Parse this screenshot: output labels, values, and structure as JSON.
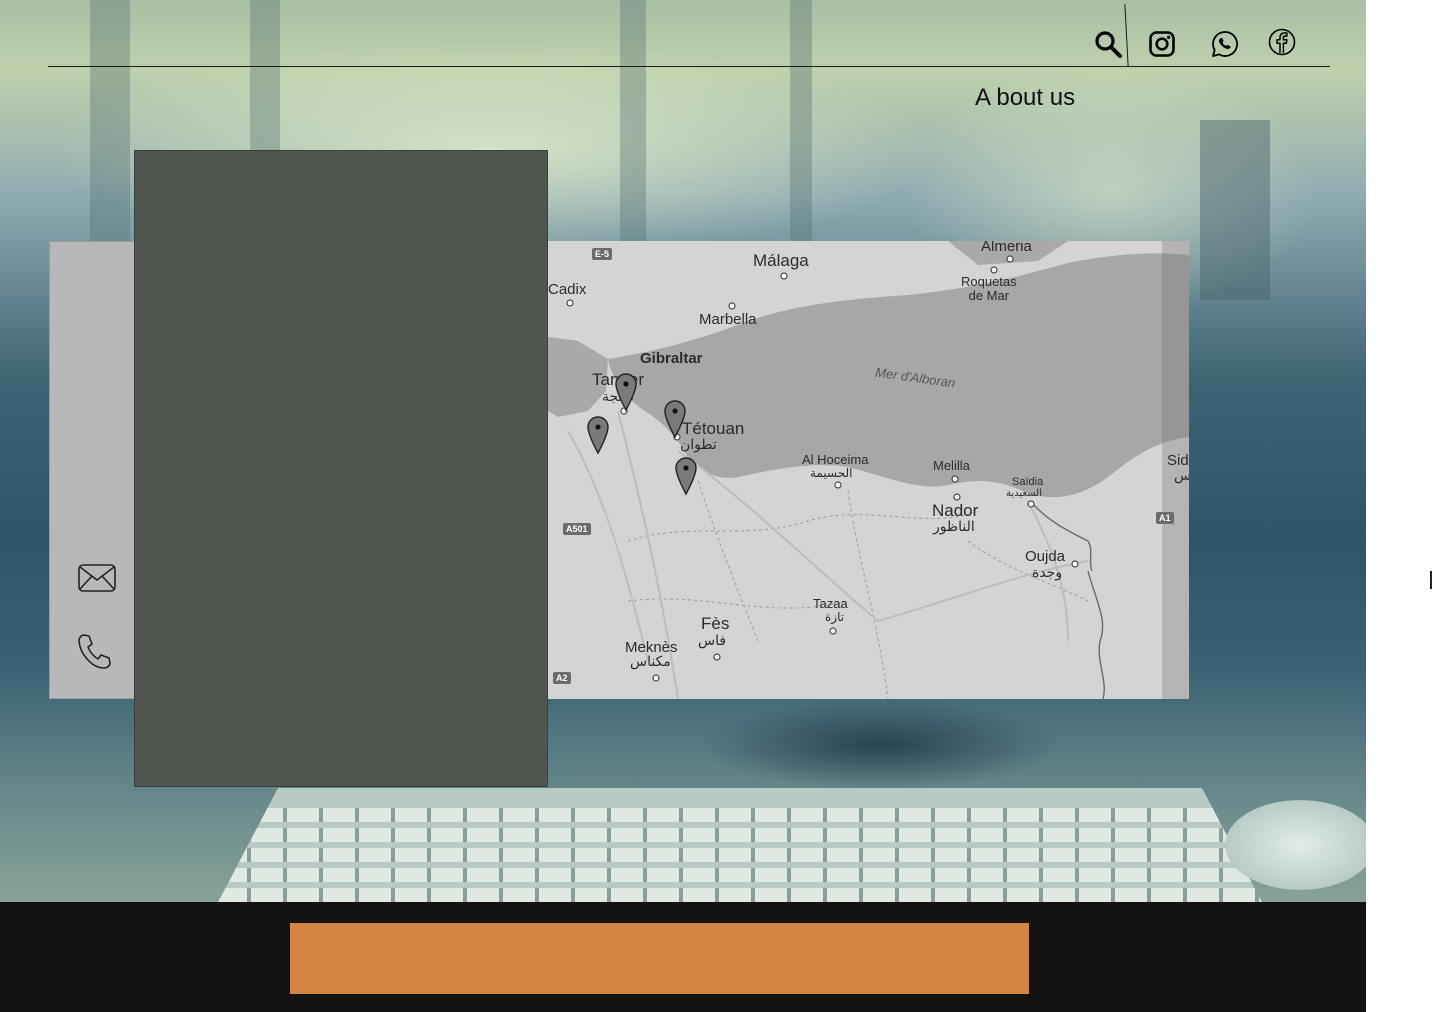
{
  "header": {
    "nav": {
      "about_label": "A bout us"
    },
    "icons": {
      "search": "search-icon",
      "instagram": "instagram-icon",
      "whatsapp": "whatsapp-icon",
      "facebook": "facebook-icon"
    }
  },
  "contact": {
    "icons": {
      "email": "envelope-icon",
      "phone": "phone-icon"
    }
  },
  "map": {
    "cities": [
      {
        "key": "malaga",
        "name": "Málaga"
      },
      {
        "key": "almeria",
        "name": "Almeria"
      },
      {
        "key": "roquetas",
        "name": "Roquetas\nde Mar"
      },
      {
        "key": "cadix",
        "name": "Cadix"
      },
      {
        "key": "marbella",
        "name": "Marbella"
      },
      {
        "key": "gibraltar",
        "name": "Gibraltar"
      },
      {
        "key": "tanger",
        "name": "Tanger"
      },
      {
        "key": "tanger_ar",
        "name": "طنجة"
      },
      {
        "key": "tetouan",
        "name": "Tétouan"
      },
      {
        "key": "tetouan_ar",
        "name": "تطوان"
      },
      {
        "key": "alhoceima",
        "name": "Al Hoceima"
      },
      {
        "key": "alhoceima_ar",
        "name": "الحسيمة"
      },
      {
        "key": "melilla",
        "name": "Melilla"
      },
      {
        "key": "nador",
        "name": "Nador"
      },
      {
        "key": "nador_ar",
        "name": "الناظور"
      },
      {
        "key": "saidia",
        "name": "Saïdia"
      },
      {
        "key": "saidia_ar",
        "name": "السعيدية"
      },
      {
        "key": "oujda",
        "name": "Oujda"
      },
      {
        "key": "oujda_ar",
        "name": "وجدة"
      },
      {
        "key": "tazaa",
        "name": "Tazaa"
      },
      {
        "key": "tazaa_ar",
        "name": "تازة"
      },
      {
        "key": "fes",
        "name": "Fès"
      },
      {
        "key": "fes_ar",
        "name": "فاس"
      },
      {
        "key": "meknes",
        "name": "Meknès"
      },
      {
        "key": "meknes_ar",
        "name": "مكناس"
      },
      {
        "key": "sid",
        "name": "Sid"
      },
      {
        "key": "sid_ar",
        "name": "س"
      }
    ],
    "sea_name": "Mer d'Alboran",
    "roads": [
      "E-5",
      "A501",
      "A1",
      "A2"
    ],
    "pins": [
      {
        "name": "map-pin-tanger"
      },
      {
        "name": "map-pin-asilah"
      },
      {
        "name": "map-pin-tetouan"
      },
      {
        "name": "map-pin-south"
      }
    ]
  },
  "colors": {
    "dark_panel": "#50554f",
    "footer": "#151312",
    "accent": "#d38644",
    "card": "#b8b8b8"
  }
}
